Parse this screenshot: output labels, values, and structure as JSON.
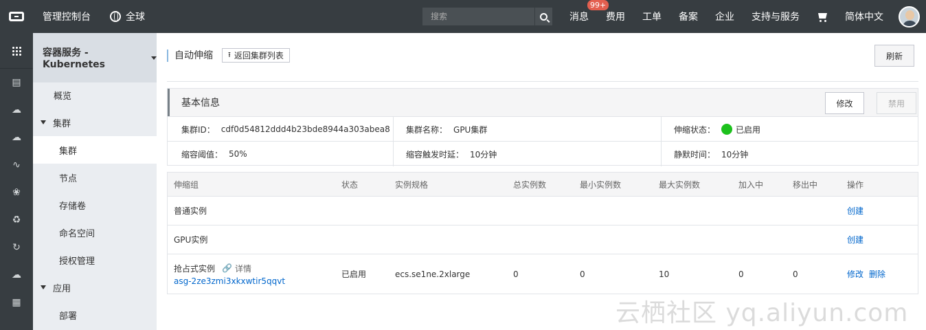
{
  "topbar": {
    "title": "管理控制台",
    "region": "全球",
    "search_placeholder": "搜索",
    "nav": [
      {
        "label": "消息",
        "badge": "99+"
      },
      {
        "label": "费用"
      },
      {
        "label": "工单"
      },
      {
        "label": "备案"
      },
      {
        "label": "企业"
      },
      {
        "label": "支持与服务"
      }
    ],
    "language": "简体中文"
  },
  "rail": {
    "icons": [
      "apps-grid-icon",
      "server-icon",
      "cloud-icon",
      "cloud-cluster-icon",
      "wave-icon",
      "molecule-icon",
      "shield-refresh-icon",
      "cloud-sync-icon",
      "cloud-upload-icon",
      "database-icon"
    ]
  },
  "sidebar": {
    "product": "容器服务 - Kubernetes",
    "items": [
      {
        "label": "概览"
      },
      {
        "label": "集群"
      },
      {
        "label": "集群"
      },
      {
        "label": "节点"
      },
      {
        "label": "存储卷"
      },
      {
        "label": "命名空间"
      },
      {
        "label": "授权管理"
      },
      {
        "label": "应用"
      },
      {
        "label": "部署"
      }
    ]
  },
  "page": {
    "title": "自动伸缩",
    "back_label": "返回集群列表",
    "refresh_label": "刷新"
  },
  "basic_info": {
    "heading": "基本信息",
    "edit_label": "修改",
    "disable_label": "禁用",
    "cluster_id_label": "集群ID：",
    "cluster_id": "cdf0d54812ddd4b23bde8944a303abea8",
    "cluster_name_label": "集群名称：",
    "cluster_name": "GPU集群",
    "scale_status_label": "伸缩状态：",
    "scale_status": "已启用",
    "status_color": "#1dc11d",
    "threshold_label": "缩容阈值：",
    "threshold": "50%",
    "trigger_delay_label": "缩容触发时延：",
    "trigger_delay": "10分钟",
    "silent_label": "静默时间：",
    "silent": "10分钟"
  },
  "groups_table": {
    "headers": [
      "伸缩组",
      "状态",
      "实例规格",
      "总实例数",
      "最小实例数",
      "最大实例数",
      "加入中",
      "移出中",
      "操作"
    ],
    "rows": [
      {
        "name": "普通实例",
        "action1": "创建"
      },
      {
        "name": "GPU实例",
        "action1": "创建"
      },
      {
        "name": "抢占式实例",
        "detail": "详情",
        "group_id": "asg-2ze3zmi3xkxwtir5qqvt",
        "status": "已启用",
        "spec": "ecs.se1ne.2xlarge",
        "total": "0",
        "min": "0",
        "max": "10",
        "joining": "0",
        "leaving": "0",
        "action1": "修改",
        "action2": "删除"
      }
    ]
  },
  "watermark": "云栖社区 yq.aliyun.com",
  "colors": {
    "topbar_bg": "#373d41",
    "sidebar_bg": "#eaedf1",
    "link": "#0066cc",
    "badge": "#e35f4f"
  }
}
